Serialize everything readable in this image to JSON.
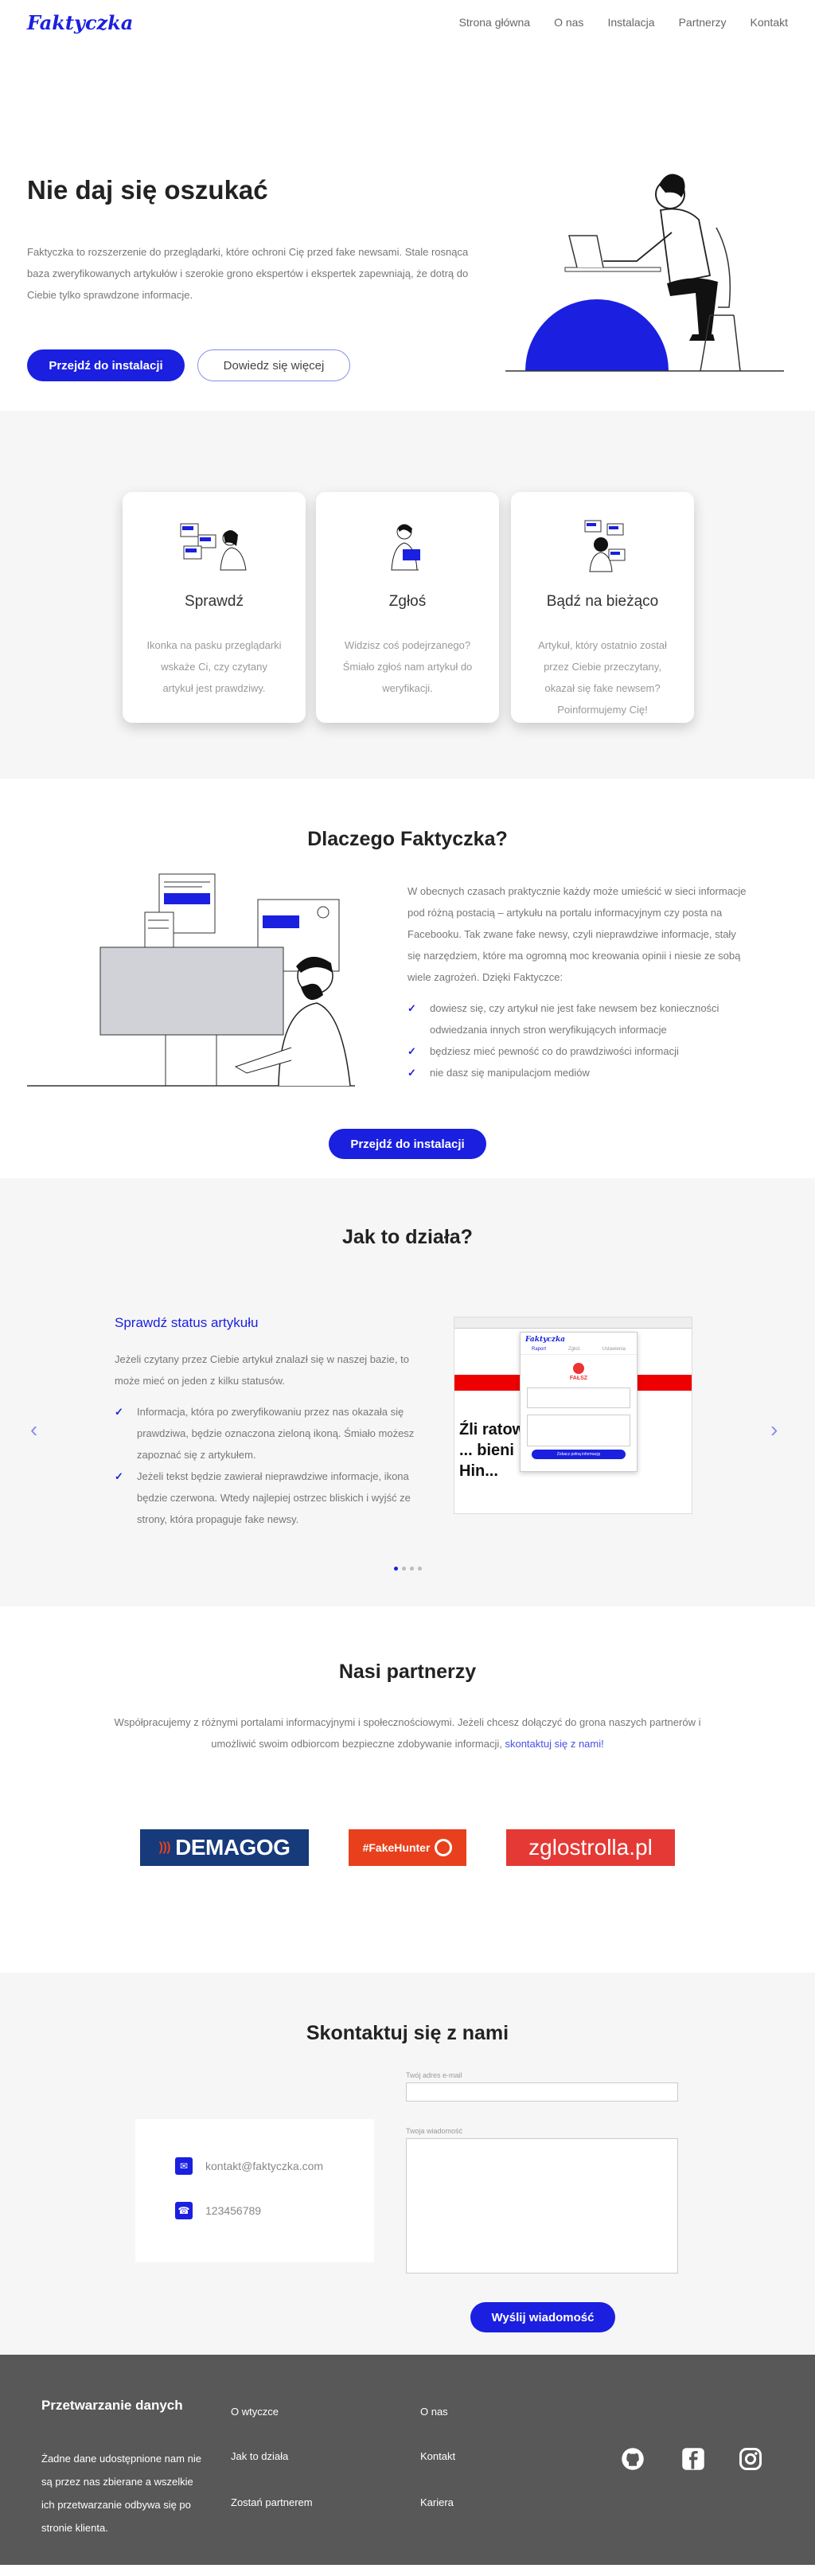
{
  "brand": {
    "logo_main": "Faktyczka",
    "accent": "#1a1fe0",
    "accent_light": "#8a8fe8"
  },
  "nav": {
    "items": [
      "Strona główna",
      "O nas",
      "Instalacja",
      "Partnerzy",
      "Kontakt"
    ]
  },
  "hero": {
    "title": "Nie daj się oszukać",
    "text": "Faktyczka to rozszerzenie do przeglądarki, które ochroni Cię przed fake newsami. Stale rosnąca baza zweryfikowanych artykułów i szerokie grono ekspertów i ekspertek zapewniają, że dotrą do Ciebie tylko sprawdzone informacje.",
    "primary_button": "Przejdź do instalacji",
    "secondary_button": "Dowiedz się więcej"
  },
  "features": [
    {
      "title": "Sprawdź",
      "text": "Ikonka na pasku przeglądarki wskaże Ci, czy czytany artykuł jest prawdziwy."
    },
    {
      "title": "Zgłoś",
      "text": "Widzisz coś podejrzanego? Śmiało zgłoś nam artykuł do weryfikacji."
    },
    {
      "title": "Bądź na bieżąco",
      "text": "Artykuł, który ostatnio został przez Ciebie przeczytany, okazał się fake newsem? Poinformujemy Cię!"
    }
  ],
  "why": {
    "title": "Dlaczego Faktyczka?",
    "text": "W obecnych czasach praktycznie każdy może umieścić w sieci informacje pod różną postacią – artykułu na portalu informacyjnym czy posta na Facebooku. Tak zwane fake newsy, czyli nieprawdziwe informacje, stały się narzędziem, które ma ogromną moc kreowania opinii i niesie ze sobą wiele zagrożeń. Dzięki Faktyczce:",
    "bullets": [
      "dowiesz się, czy artykuł nie jest fake newsem bez konieczności odwiedzania innych stron weryfikujących informacje",
      "będziesz mieć pewność co do prawdziwości informacji",
      "nie dasz się manipulacjom mediów"
    ],
    "button": "Przejdź do instalacji"
  },
  "how": {
    "title": "Jak to działa?",
    "slide_title": "Sprawdź status artykułu",
    "slide_text": "Jeżeli czytany przez Ciebie artykuł znalazł się w naszej bazie, to może mieć on jeden z kilku statusów.",
    "bullets": [
      "Informacja, która po zweryfikowaniu przez nas okazała się prawdziwa, będzie oznaczona zieloną ikoną. Śmiało możesz zapoznać się z artykułem.",
      "Jeżeli tekst będzie zawierał nieprawdziwe informacje, ikona będzie czerwona. Wtedy najlepiej ostrzec bliskich i wyjść ze strony, która propaguje fake newsy."
    ],
    "popup": {
      "tab1": "Raport",
      "tab2": "Zgłoś",
      "tab3": "Ustawienia",
      "status": "FAŁSZ",
      "button": "Zobacz pełną informację"
    },
    "article_headline": "Źli ratowni ... bieni Hin..."
  },
  "partners": {
    "title": "Nasi partnerzy",
    "text": "Współpracujemy z różnymi portalami informacyjnymi i społecznościowymi. Jeżeli chcesz dołączyć do grona naszych partnerów i umożliwić swoim odbiorcom bezpieczne zdobywanie informacji, ",
    "link": "skontaktuj się z nami!",
    "logos": [
      "DEMAGOG",
      "#FakeHunter",
      "zglostrolla.pl"
    ]
  },
  "contact": {
    "title": "Skontaktuj się z nami",
    "email": "kontakt@faktyczka.com",
    "phone": "123456789",
    "email_label": "Twój adres e-mail",
    "message_label": "Twoja wiadomość",
    "send": "Wyślij wiadomość"
  },
  "footer": {
    "title": "Przetwarzanie danych",
    "text": "Żadne dane udostępnione nam nie są przez nas zbierane a wszelkie ich przetwarzanie odbywa się po stronie klienta.",
    "col1": [
      "O wtyczce",
      "Jak to działa",
      "Zostań partnerem"
    ],
    "col2": [
      "O nas",
      "Kontakt",
      "Kariera"
    ],
    "social": [
      "github-icon",
      "facebook-icon",
      "instagram-icon"
    ]
  }
}
